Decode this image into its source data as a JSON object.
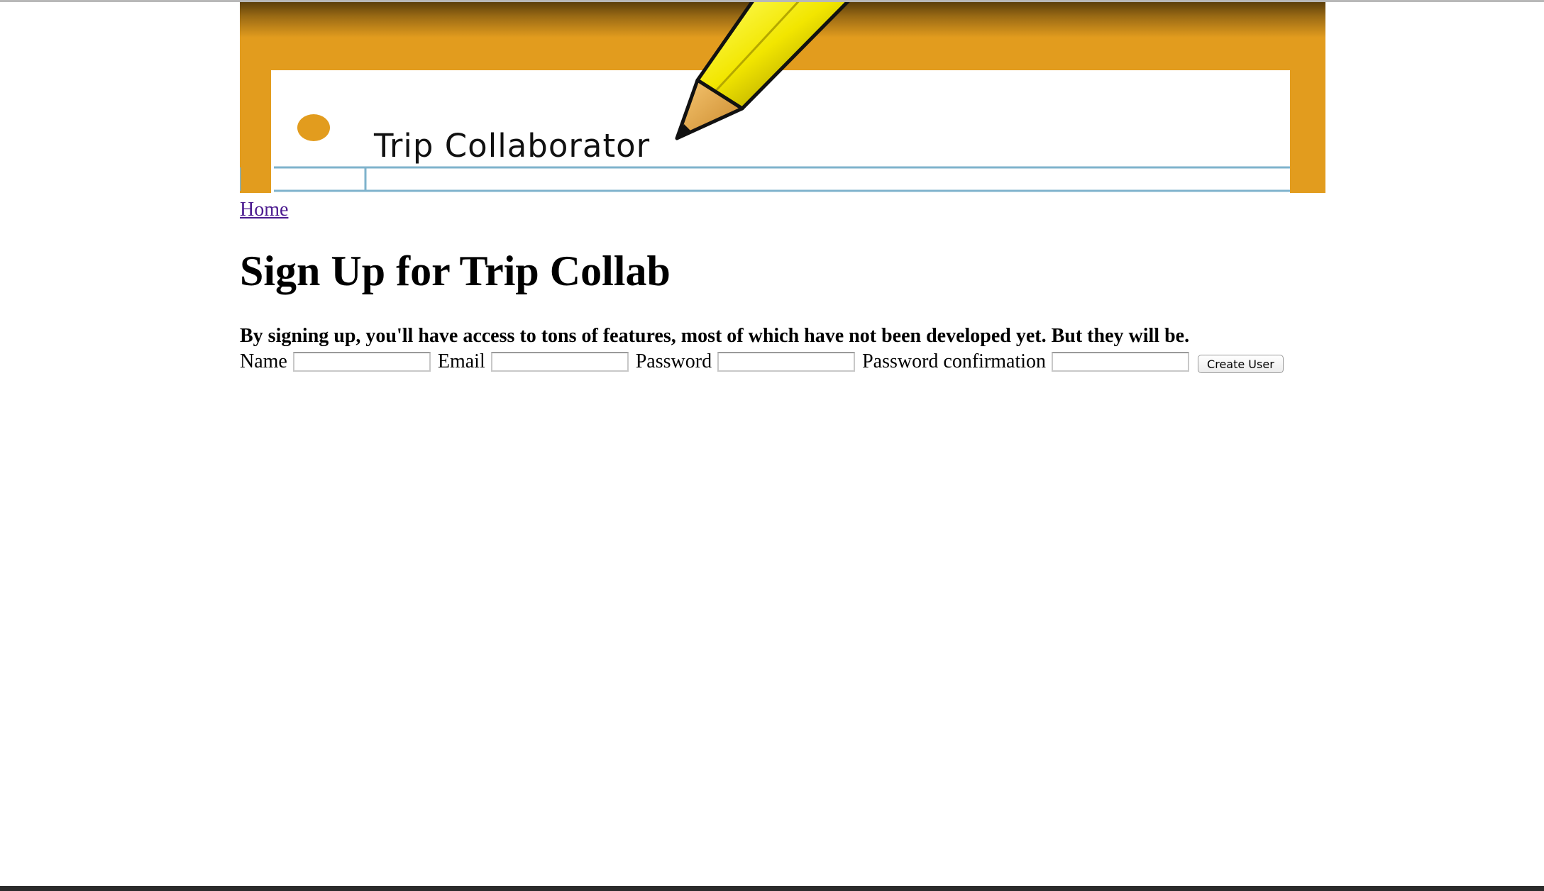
{
  "banner": {
    "title": "Trip Collaborator",
    "colors": {
      "frame": "#e29c1e",
      "rule_line": "#7fb3cc",
      "pencil_body": "#f2e600",
      "pencil_tip": "#e8a844",
      "dot": "#e29c1e"
    },
    "icons": [
      "pencil-icon",
      "dot-icon"
    ]
  },
  "nav": {
    "home_label": "Home"
  },
  "page": {
    "title": "Sign Up for Trip Collab",
    "intro": "By signing up, you'll have access to tons of features, most of which have not been developed yet. But they will be."
  },
  "form": {
    "fields": [
      {
        "label": "Name",
        "value": ""
      },
      {
        "label": "Email",
        "value": ""
      },
      {
        "label": "Password",
        "value": ""
      },
      {
        "label": "Password confirmation",
        "value": ""
      }
    ],
    "submit_label": "Create User"
  }
}
